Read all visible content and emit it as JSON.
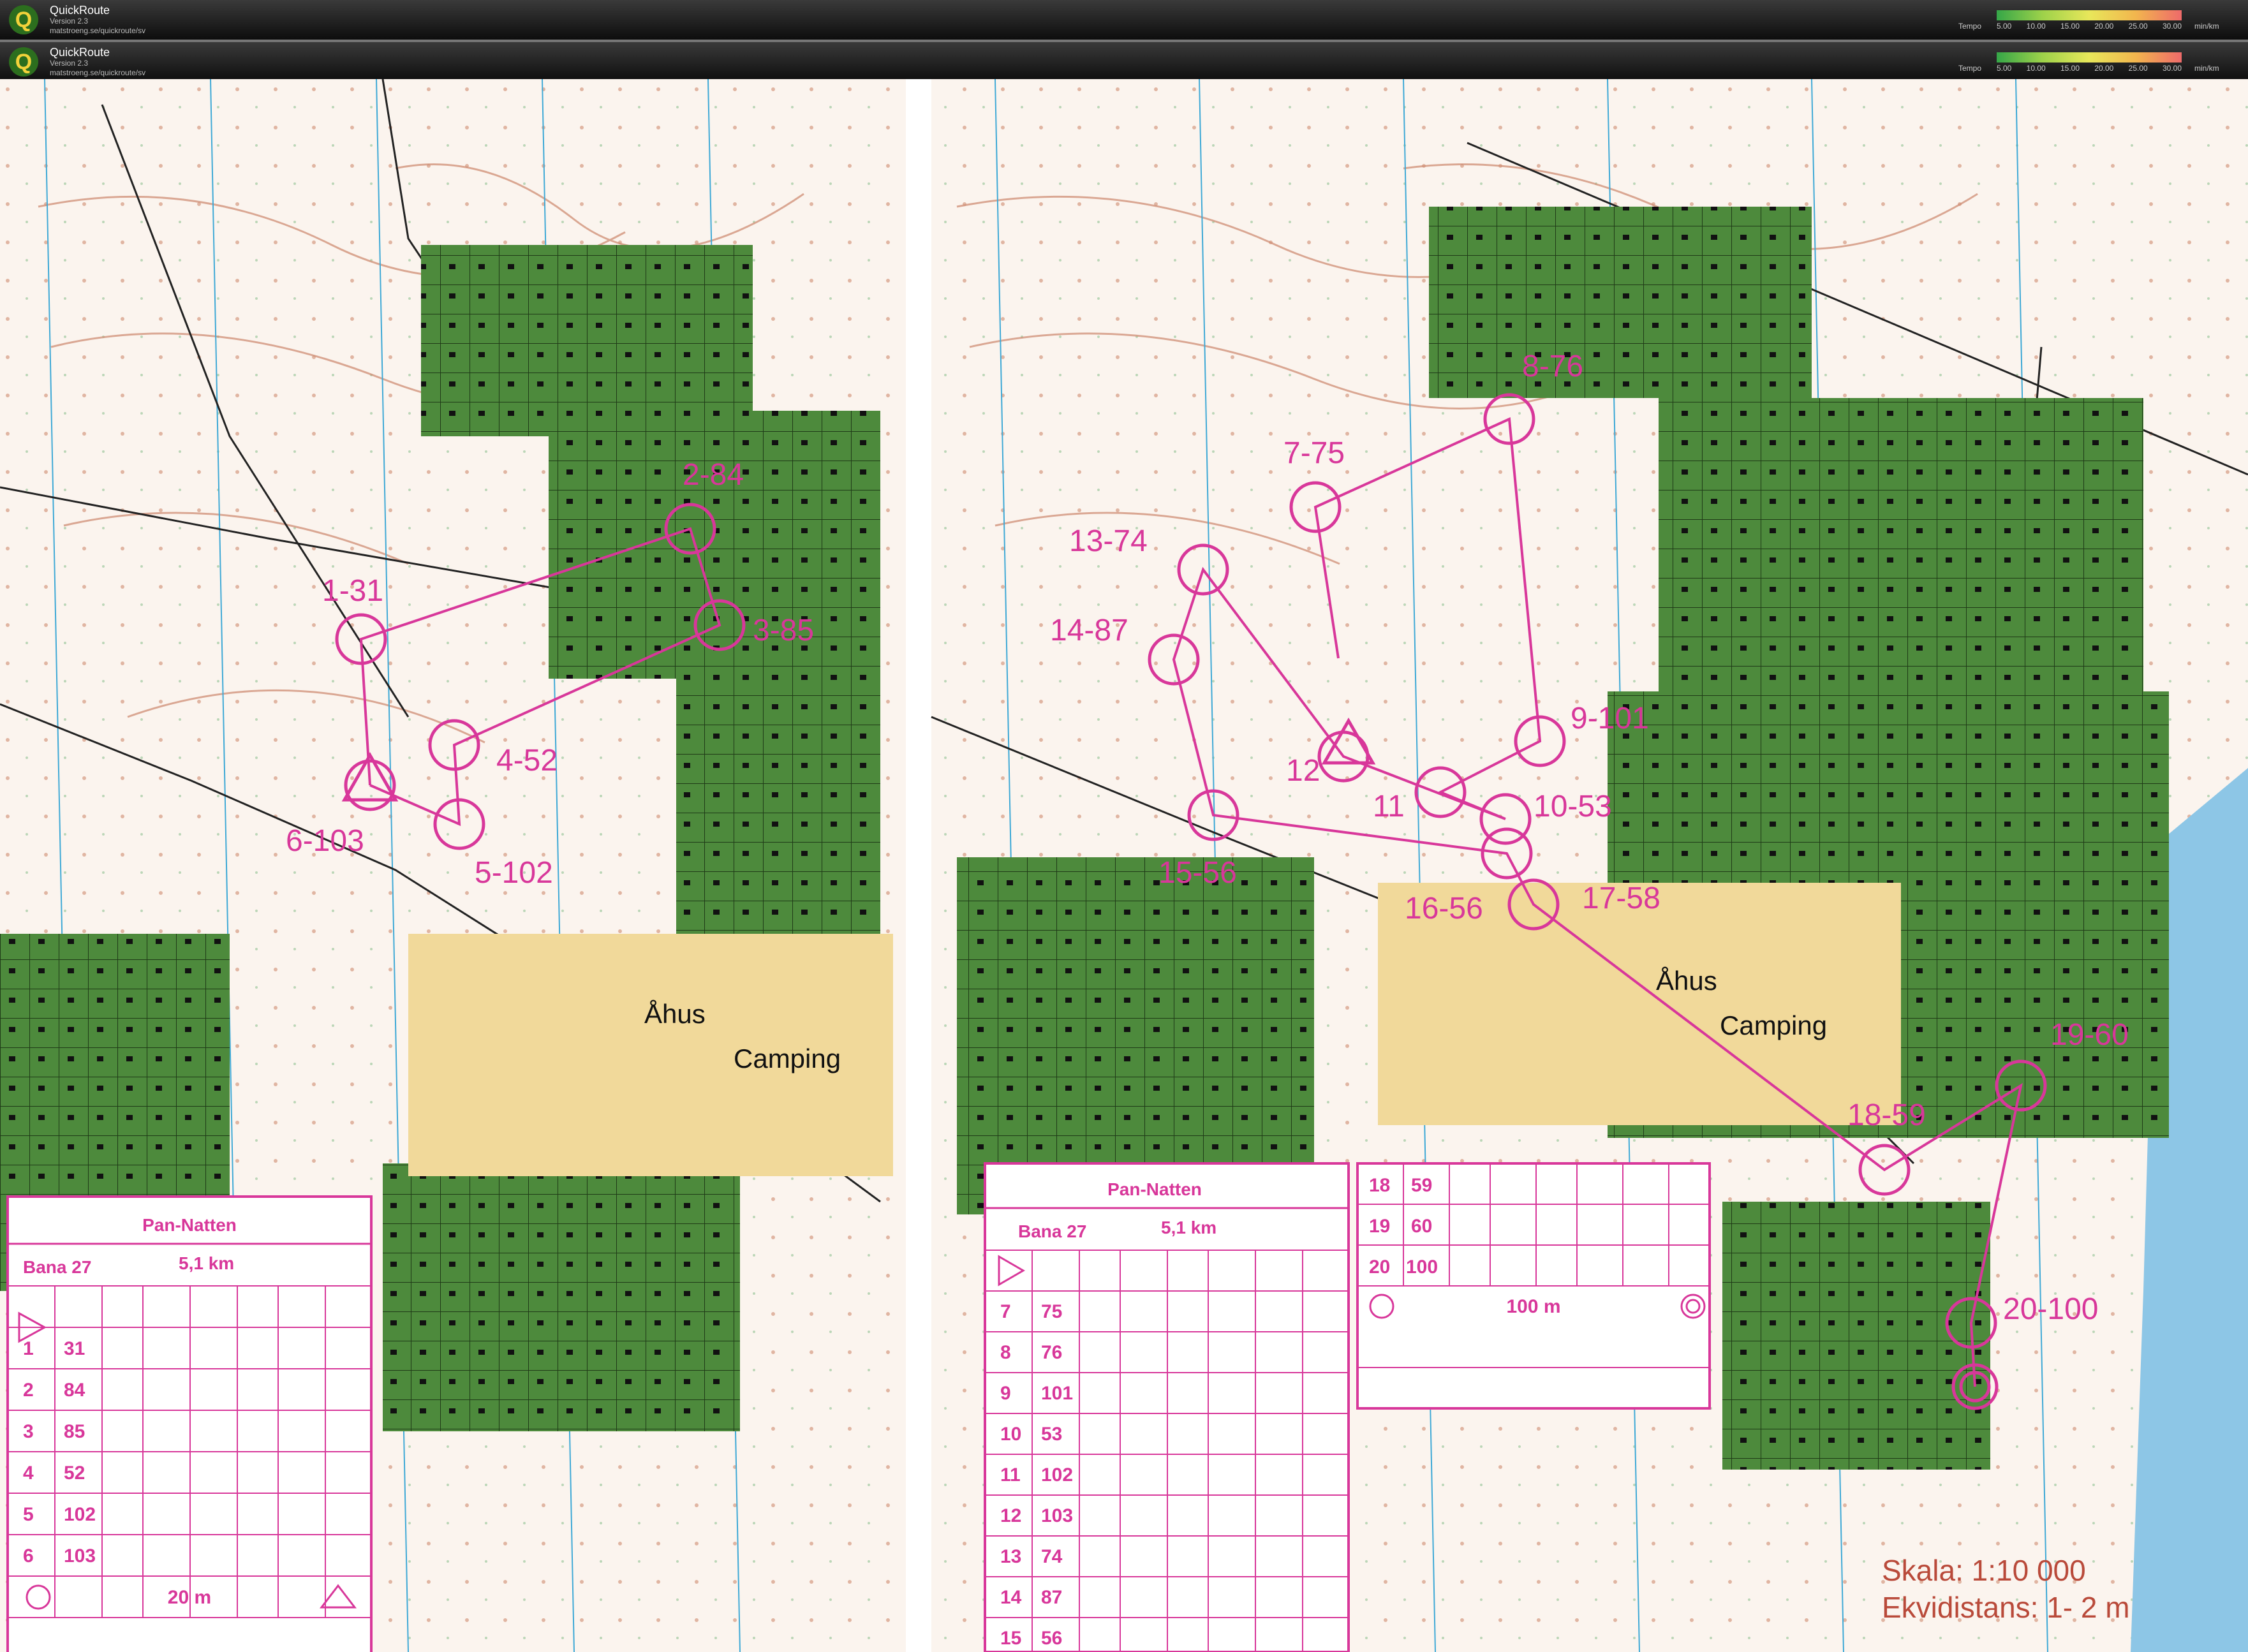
{
  "app": {
    "name": "QuickRoute",
    "version": "Version 2.3",
    "url": "matstroeng.se/quickroute/sv",
    "tempo_label": "Tempo",
    "tempo_ticks": [
      "5.00",
      "10.00",
      "15.00",
      "20.00",
      "25.00",
      "30.00"
    ],
    "tempo_unit": "min/km"
  },
  "colors": {
    "course": "#d8379a",
    "vegetation": "#4d8a3c",
    "water": "#8dc6e6",
    "contour": "#c9866a",
    "camping": "#f1d99a"
  },
  "icons": [
    "quickroute-logo",
    "start-triangle",
    "finish-circle",
    "control-circle"
  ],
  "maps": {
    "left": {
      "controls": [
        "1-31",
        "2-84",
        "3-85",
        "4-52",
        "5-102",
        "6-103"
      ],
      "place_names": [
        "Åhus",
        "Camping"
      ],
      "control_card": {
        "event": "Pan-Natten",
        "course": "Bana 27",
        "length": "5,1 km",
        "rows": [
          [
            "1",
            "31"
          ],
          [
            "2",
            "84"
          ],
          [
            "3",
            "85"
          ],
          [
            "4",
            "52"
          ],
          [
            "5",
            "102"
          ],
          [
            "6",
            "103"
          ]
        ],
        "finish_distance": "20 m"
      }
    },
    "right": {
      "controls": [
        "7-75",
        "8-76",
        "9-101",
        "10-53",
        "11",
        "12",
        "13-74",
        "14-87",
        "15-56",
        "16-56",
        "17-58",
        "18-59",
        "19-60",
        "20-100"
      ],
      "place_names": [
        "Åhus",
        "Camping"
      ],
      "control_card_main": {
        "event": "Pan-Natten",
        "course": "Bana 27",
        "length": "5,1 km",
        "rows": [
          [
            "7",
            "75"
          ],
          [
            "8",
            "76"
          ],
          [
            "9",
            "101"
          ],
          [
            "10",
            "53"
          ],
          [
            "11",
            "102"
          ],
          [
            "12",
            "103"
          ],
          [
            "13",
            "74"
          ],
          [
            "14",
            "87"
          ],
          [
            "15",
            "56"
          ]
        ]
      },
      "control_card_end": {
        "rows": [
          [
            "18",
            "59"
          ],
          [
            "19",
            "60"
          ],
          [
            "20",
            "100"
          ]
        ],
        "finish_distance": "100 m"
      },
      "scale": "Skala: 1:10 000",
      "contour_interval": "Ekvidistans: 1- 2 m"
    }
  }
}
